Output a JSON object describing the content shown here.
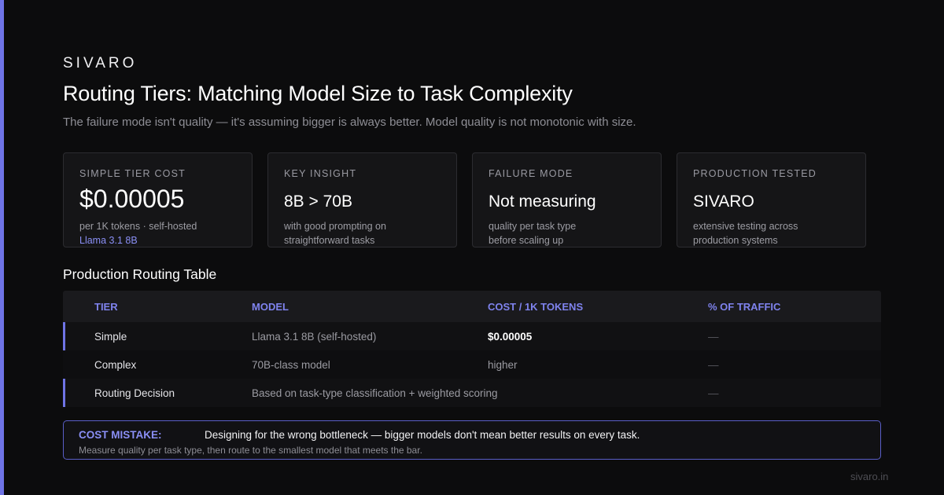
{
  "brand": "SIVARO",
  "title": "Routing Tiers: Matching Model Size to Task Complexity",
  "subtitle": "The failure mode isn't quality — it's assuming bigger is always better. Model quality is not monotonic with size.",
  "cards": [
    {
      "label": "SIMPLE TIER COST",
      "value": "$0.00005",
      "desc1": "per 1K tokens · self-hosted",
      "desc2": "Llama 3.1 8B"
    },
    {
      "label": "KEY INSIGHT",
      "value": "8B > 70B",
      "desc1": "with good prompting on",
      "desc2": "straightforward tasks"
    },
    {
      "label": "FAILURE MODE",
      "value": "Not measuring",
      "desc1": "quality per task type",
      "desc2": "before scaling up"
    },
    {
      "label": "PRODUCTION TESTED",
      "value": "SIVARO",
      "desc1": "extensive testing across",
      "desc2": "production systems"
    }
  ],
  "table": {
    "title": "Production Routing Table",
    "headers": [
      "TIER",
      "MODEL",
      "COST / 1K TOKENS",
      "% OF TRAFFIC"
    ],
    "rows": [
      {
        "tier": "Simple",
        "model": "Llama 3.1 8B (self-hosted)",
        "cost": "$0.00005",
        "traffic": "—"
      },
      {
        "tier": "Complex",
        "model": "70B-class model",
        "cost": "higher",
        "traffic": "—"
      },
      {
        "tier": "Routing Decision",
        "model": "Based on task-type classification + weighted scoring",
        "cost": "",
        "traffic": "—"
      }
    ]
  },
  "callout": {
    "label": "COST MISTAKE:",
    "text": "Designing for the wrong bottleneck — bigger models don't mean better results on every task.",
    "sub": "Measure quality per task type, then route to the smallest model that meets the bar."
  },
  "footer": "sivaro.in",
  "colors": {
    "accent": "#6f74e6",
    "accent_text": "#8a8ff5",
    "background": "#0c0c0d"
  }
}
